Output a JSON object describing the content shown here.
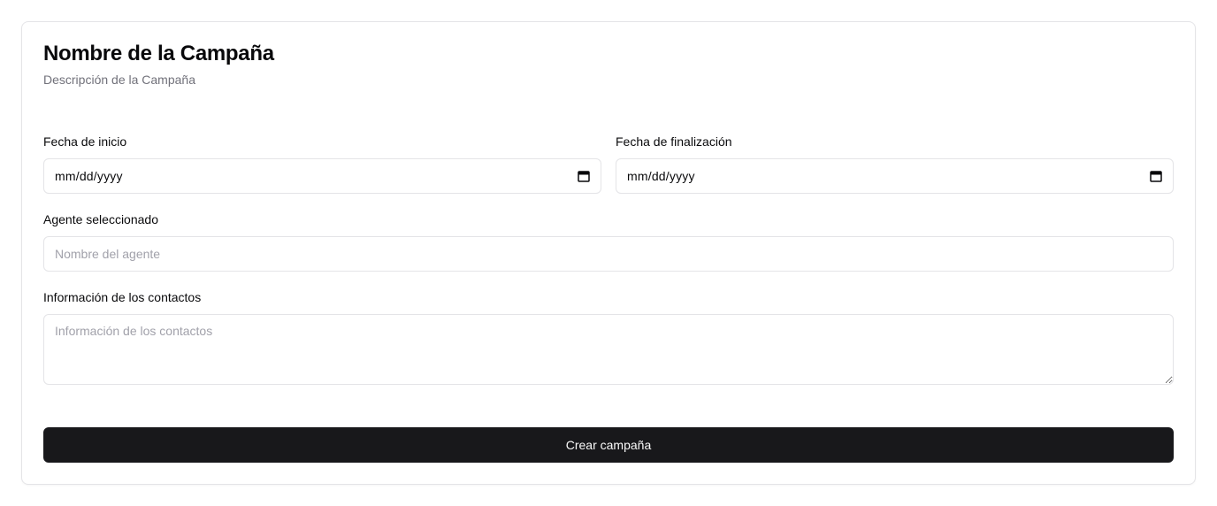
{
  "campaign": {
    "title": "Nombre de la Campaña",
    "description": "Descripción de la Campaña"
  },
  "form": {
    "start_date": {
      "label": "Fecha de inicio",
      "value": "mm/dd/yyyy",
      "icon": "calendar-icon"
    },
    "end_date": {
      "label": "Fecha de finalización",
      "value": "mm/dd/yyyy",
      "icon": "calendar-icon"
    },
    "agent": {
      "label": "Agente seleccionado",
      "value": "",
      "placeholder": "Nombre del agente"
    },
    "contacts": {
      "label": "Información de los contactos",
      "value": "",
      "placeholder": "Información de los contactos"
    },
    "submit_label": "Crear campaña"
  },
  "colors": {
    "primary_button_bg": "#18181b",
    "primary_button_text": "#fafafa",
    "border": "#e4e4e7",
    "muted_text": "#71717a",
    "placeholder": "#a1a1aa"
  }
}
